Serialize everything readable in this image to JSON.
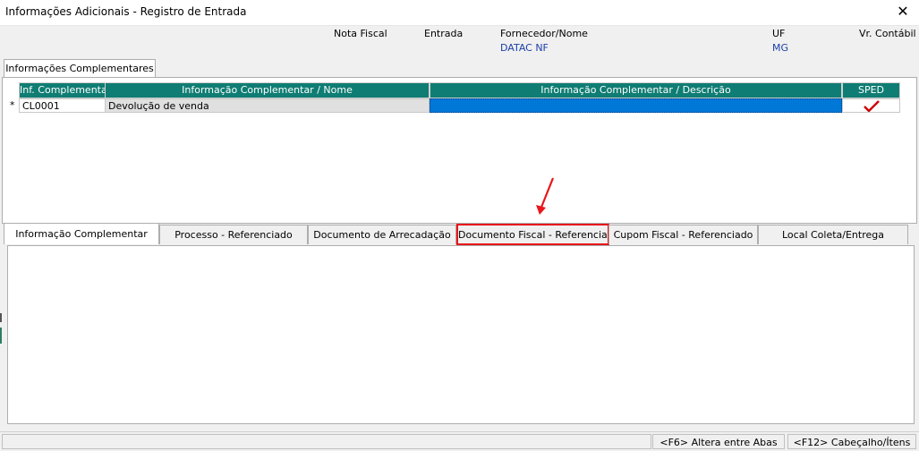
{
  "window": {
    "title": "Informações Adicionais - Registro de Entrada",
    "close_glyph": "✕"
  },
  "header": {
    "nota_fiscal_label": "Nota Fiscal",
    "entrada_label": "Entrada",
    "fornecedor_label": "Fornecedor/Nome",
    "fornecedor_value": "DATAC NF",
    "uf_label": "UF",
    "uf_value": "MG",
    "vr_contabil_label": "Vr. Contábil"
  },
  "section_tab": {
    "label": "Informações Complementares"
  },
  "grid": {
    "columns": [
      "Inf. Complementar",
      "Informação Complementar / Nome",
      "Informação Complementar / Descrição",
      "SPED"
    ],
    "rows": [
      {
        "marker": "*",
        "codigo": "CL0001",
        "nome": "Devolução de venda",
        "descricao": "",
        "sped_icon": "checkmark-icon"
      }
    ]
  },
  "lower_tabs": [
    {
      "label": "Informação Complementar",
      "active": true
    },
    {
      "label": "Processo - Referenciado"
    },
    {
      "label": "Documento de Arrecadação"
    },
    {
      "label": "Documento Fiscal - Referenciado",
      "highlighted": true
    },
    {
      "label": "Cupom Fiscal - Referenciado"
    },
    {
      "label": "Local Coleta/Entrega"
    }
  ],
  "status": {
    "f6": "<F6> Altera entre Abas",
    "f12": "<F12> Cabeçalho/Ítens"
  },
  "colors": {
    "grid_header": "#0f7d73",
    "selection": "#0078d7",
    "highlight": "#e8161b",
    "check": "#cc0000"
  }
}
